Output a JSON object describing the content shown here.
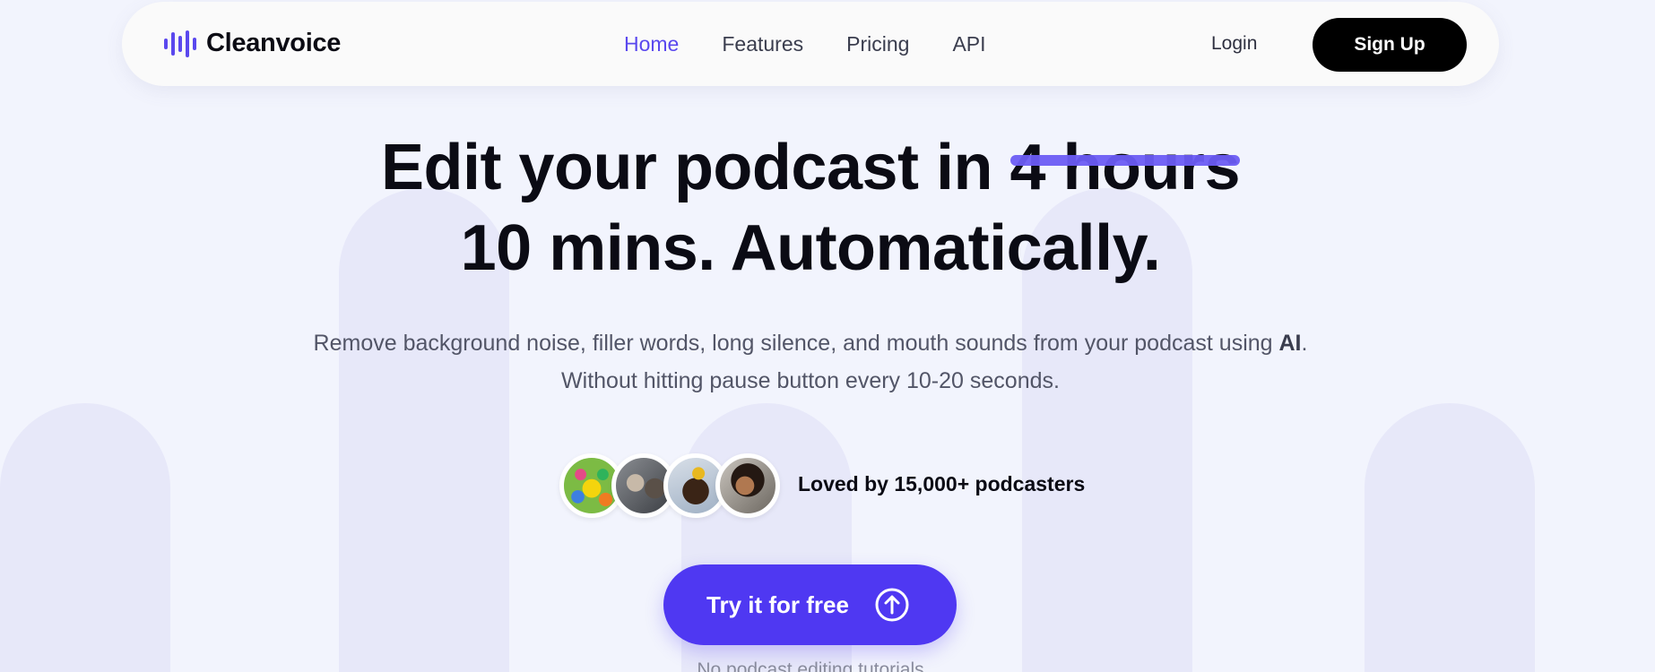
{
  "navbar": {
    "logo_text": "Cleanvoice",
    "links": [
      {
        "label": "Home",
        "active": true
      },
      {
        "label": "Features",
        "active": false
      },
      {
        "label": "Pricing",
        "active": false
      },
      {
        "label": "API",
        "active": false
      }
    ],
    "login_label": "Login",
    "signup_label": "Sign Up"
  },
  "hero": {
    "title_prefix": "Edit your podcast in ",
    "title_struck": "4 hours",
    "title_line2": "10 mins. Automatically.",
    "subtitle_line1_prefix": "Remove background noise, filler words, long silence, and mouth sounds from your podcast using ",
    "subtitle_line1_bold": "AI",
    "subtitle_line1_suffix": ".",
    "subtitle_line2": "Without hitting pause button every 10-20 seconds."
  },
  "social_proof": {
    "avatars": [
      "avatar-1",
      "avatar-2",
      "avatar-3",
      "avatar-4"
    ],
    "text": "Loved by 15,000+ podcasters"
  },
  "cta": {
    "label": "Try it for free",
    "icon": "arrow-up-circle-icon",
    "note": "No podcast editing tutorials"
  },
  "colors": {
    "accent": "#4f38f2",
    "accent_light": "#6b5cf4",
    "background": "#f2f4fd",
    "pillar": "#e7e8f9",
    "signup_bg": "#000000"
  }
}
